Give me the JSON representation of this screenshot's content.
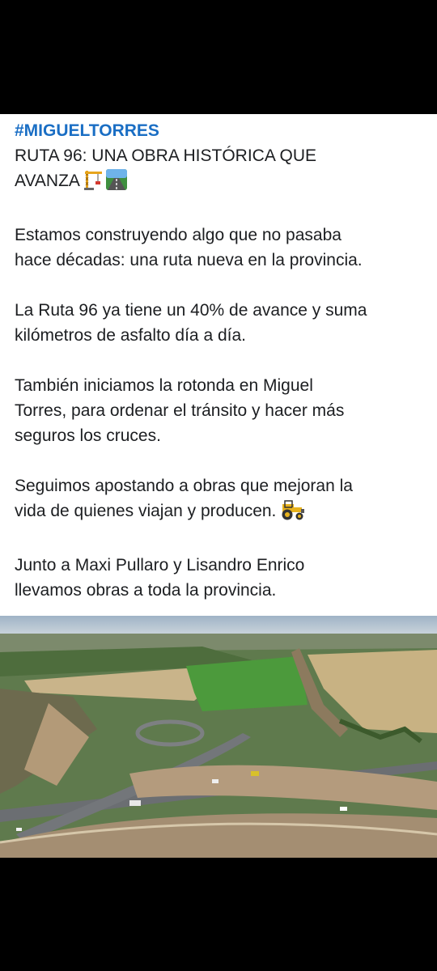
{
  "post": {
    "hashtag": "#MIGUELTORRES",
    "title_line1": "RUTA 96: UNA OBRA HISTÓRICA QUE",
    "title_line2": "AVANZA",
    "title_emojis": [
      "crane-icon",
      "road-icon"
    ],
    "p1_line1": "Estamos construyendo algo que no pasaba",
    "p1_line2": "hace décadas: una ruta nueva en la provincia.",
    "p2_line1": "La Ruta 96 ya tiene un 40% de avance y suma",
    "p2_line2": "kilómetros de asfalto día a día.",
    "p3_line1": "También iniciamos la rotonda en Miguel",
    "p3_line2": "Torres, para ordenar el tránsito y hacer más",
    "p3_line3": "seguros los cruces.",
    "p4_line1": "Seguimos apostando a obras que mejoran la",
    "p4_line2": "vida de quienes viajan y producen.",
    "p4_emoji": "tractor-icon",
    "p5_line1": "Junto a Maxi Pullaro y Lisandro Enrico",
    "p5_line2": "llevamos obras a toda la provincia."
  },
  "colors": {
    "hashtag": "#1a6ec4",
    "text": "#1c1e21",
    "background": "#ffffff",
    "frame": "#000000"
  },
  "photo": {
    "subject": "aerial-road-construction-photo"
  }
}
